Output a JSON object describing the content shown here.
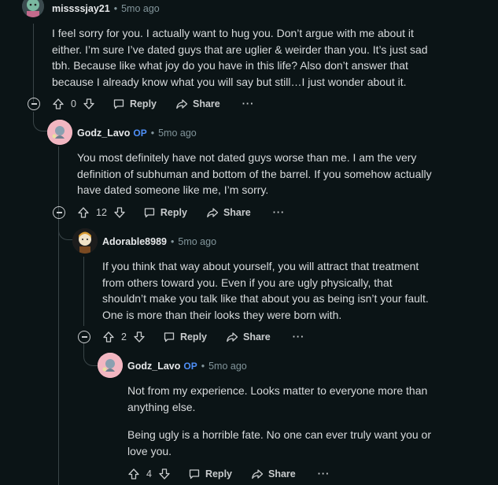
{
  "comments": [
    {
      "author": "missssjay21",
      "op": "",
      "time": "5mo ago",
      "body": [
        "I feel sorry for you. I actually want to hug you. Don’t argue with me about it either. I’m sure I’ve dated guys that are uglier & weirder than you. It’s just sad tbh. Because like what joy do you have in this life? Also don’t answer that because I already know what you will say but still…I just wonder about it."
      ],
      "votes": "0",
      "reply": "Reply",
      "share": "Share",
      "more": "···"
    },
    {
      "author": "Godz_Lavo",
      "op": "OP",
      "time": "5mo ago",
      "body": [
        "You most definitely have not dated guys worse than me. I am the very definition of subhuman and bottom of the barrel. If you somehow actually have dated someone like me, I’m sorry."
      ],
      "votes": "12",
      "reply": "Reply",
      "share": "Share",
      "more": "···"
    },
    {
      "author": "Adorable8989",
      "op": "",
      "time": "5mo ago",
      "body": [
        "If you think that way about yourself, you will attract that treatment from others toward you. Even if you are ugly physically, that shouldn’t make you talk like that about you as being isn’t your fault. One is more than their looks they were born with."
      ],
      "votes": "2",
      "reply": "Reply",
      "share": "Share",
      "more": "···"
    },
    {
      "author": "Godz_Lavo",
      "op": "OP",
      "time": "5mo ago",
      "body": [
        "Not from my experience. Looks matter to everyone more than anything else.",
        "Being ugly is a horrible fate. No one can ever truly want you or love you."
      ],
      "votes": "4",
      "reply": "Reply",
      "share": "Share",
      "more": "···"
    }
  ],
  "separator": "•",
  "icons": [
    "upvote-icon",
    "downvote-icon",
    "reply-icon",
    "share-icon",
    "collapse-icon"
  ],
  "colors": {
    "background": "#0b1416",
    "op": "#4f8ff7",
    "thread_line": "#3a4548"
  }
}
